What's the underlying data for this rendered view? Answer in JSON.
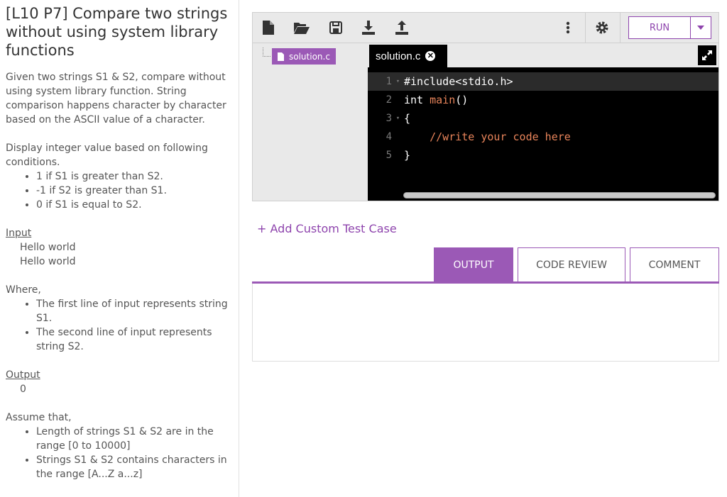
{
  "problem": {
    "title": "[L10 P7] Compare two strings without using system library functions",
    "description": "Given two strings S1 & S2, compare without using system library function. String comparison happens character by character based on the ASCII value of a character.",
    "conditions_intro": "Display integer value based on following conditions.",
    "conditions": [
      "1 if S1 is greater than S2.",
      "-1 if S2 is greater than S1.",
      "0 if S1 is equal to S2."
    ],
    "input_heading": "Input",
    "input_lines": [
      "Hello world",
      "Hello world"
    ],
    "where_heading": "Where,",
    "where_items": [
      "The first line of input represents string S1.",
      "The second line of input represents string S2."
    ],
    "output_heading": "Output",
    "output_value": "0",
    "assume_heading": "Assume that,",
    "assume_items": [
      "Length of strings S1 & S2 are in the range [0 to 10000]",
      "Strings S1 & S2 contains characters in the range [A...Z a...z]"
    ]
  },
  "toolbar": {
    "icons": [
      "new-file-icon",
      "open-folder-icon",
      "save-icon",
      "download-icon",
      "upload-icon",
      "more-vertical-icon",
      "settings-gear-icon"
    ],
    "run_label": "RUN"
  },
  "file_tree": {
    "file_name": "solution.c"
  },
  "editor": {
    "tab_name": "solution.c",
    "lines": [
      {
        "num": "1",
        "fold": "▾",
        "code": "#include<stdio.h>"
      },
      {
        "num": "2",
        "fold": "",
        "code": "int main()"
      },
      {
        "num": "3",
        "fold": "▾",
        "code": "{"
      },
      {
        "num": "4",
        "fold": "",
        "code": "    //write your code here"
      },
      {
        "num": "5",
        "fold": "",
        "code": "}"
      }
    ]
  },
  "add_test_case_label": "+ Add Custom Test Case",
  "output_tabs": [
    {
      "label": "OUTPUT",
      "active": true
    },
    {
      "label": "CODE REVIEW",
      "active": false
    },
    {
      "label": "COMMENT",
      "active": false
    }
  ],
  "colors": {
    "accent": "#9b59b6",
    "accent_dark": "#8e44ad",
    "code_keyword": "#e8845a"
  }
}
